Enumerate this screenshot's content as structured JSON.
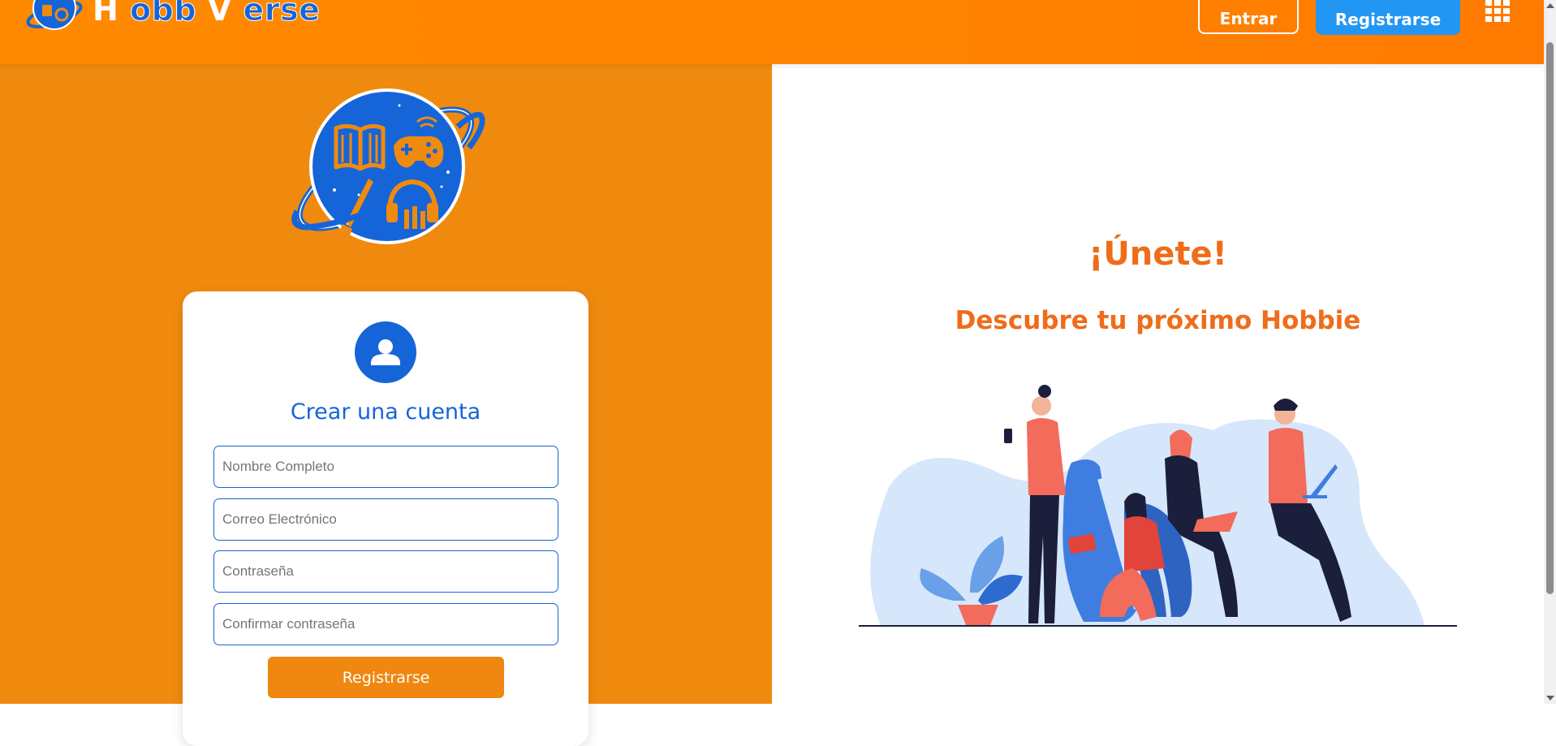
{
  "header": {
    "brand_part1": "H",
    "brand_part2": "obb",
    "brand_part3": "V",
    "brand_part4": "erse",
    "login_label": "Entrar",
    "register_label": "Registrarse",
    "apps_icon": "grid-icon"
  },
  "signup": {
    "avatar_icon": "user-icon",
    "title": "Crear una cuenta",
    "fields": {
      "full_name_placeholder": "Nombre Completo",
      "email_placeholder": "Correo Electrónico",
      "password_placeholder": "Contraseña",
      "confirm_password_placeholder": "Confirmar contraseña"
    },
    "submit_label": "Registrarse"
  },
  "promo": {
    "headline": "¡Únete!",
    "subheadline": "Descubre tu próximo Hobbie"
  },
  "colors": {
    "header_orange": "#ff8400",
    "panel_orange": "#f08a0e",
    "accent_blue": "#1565d8",
    "button_blue": "#2196f3",
    "headline_orange": "#ef6c1a"
  }
}
